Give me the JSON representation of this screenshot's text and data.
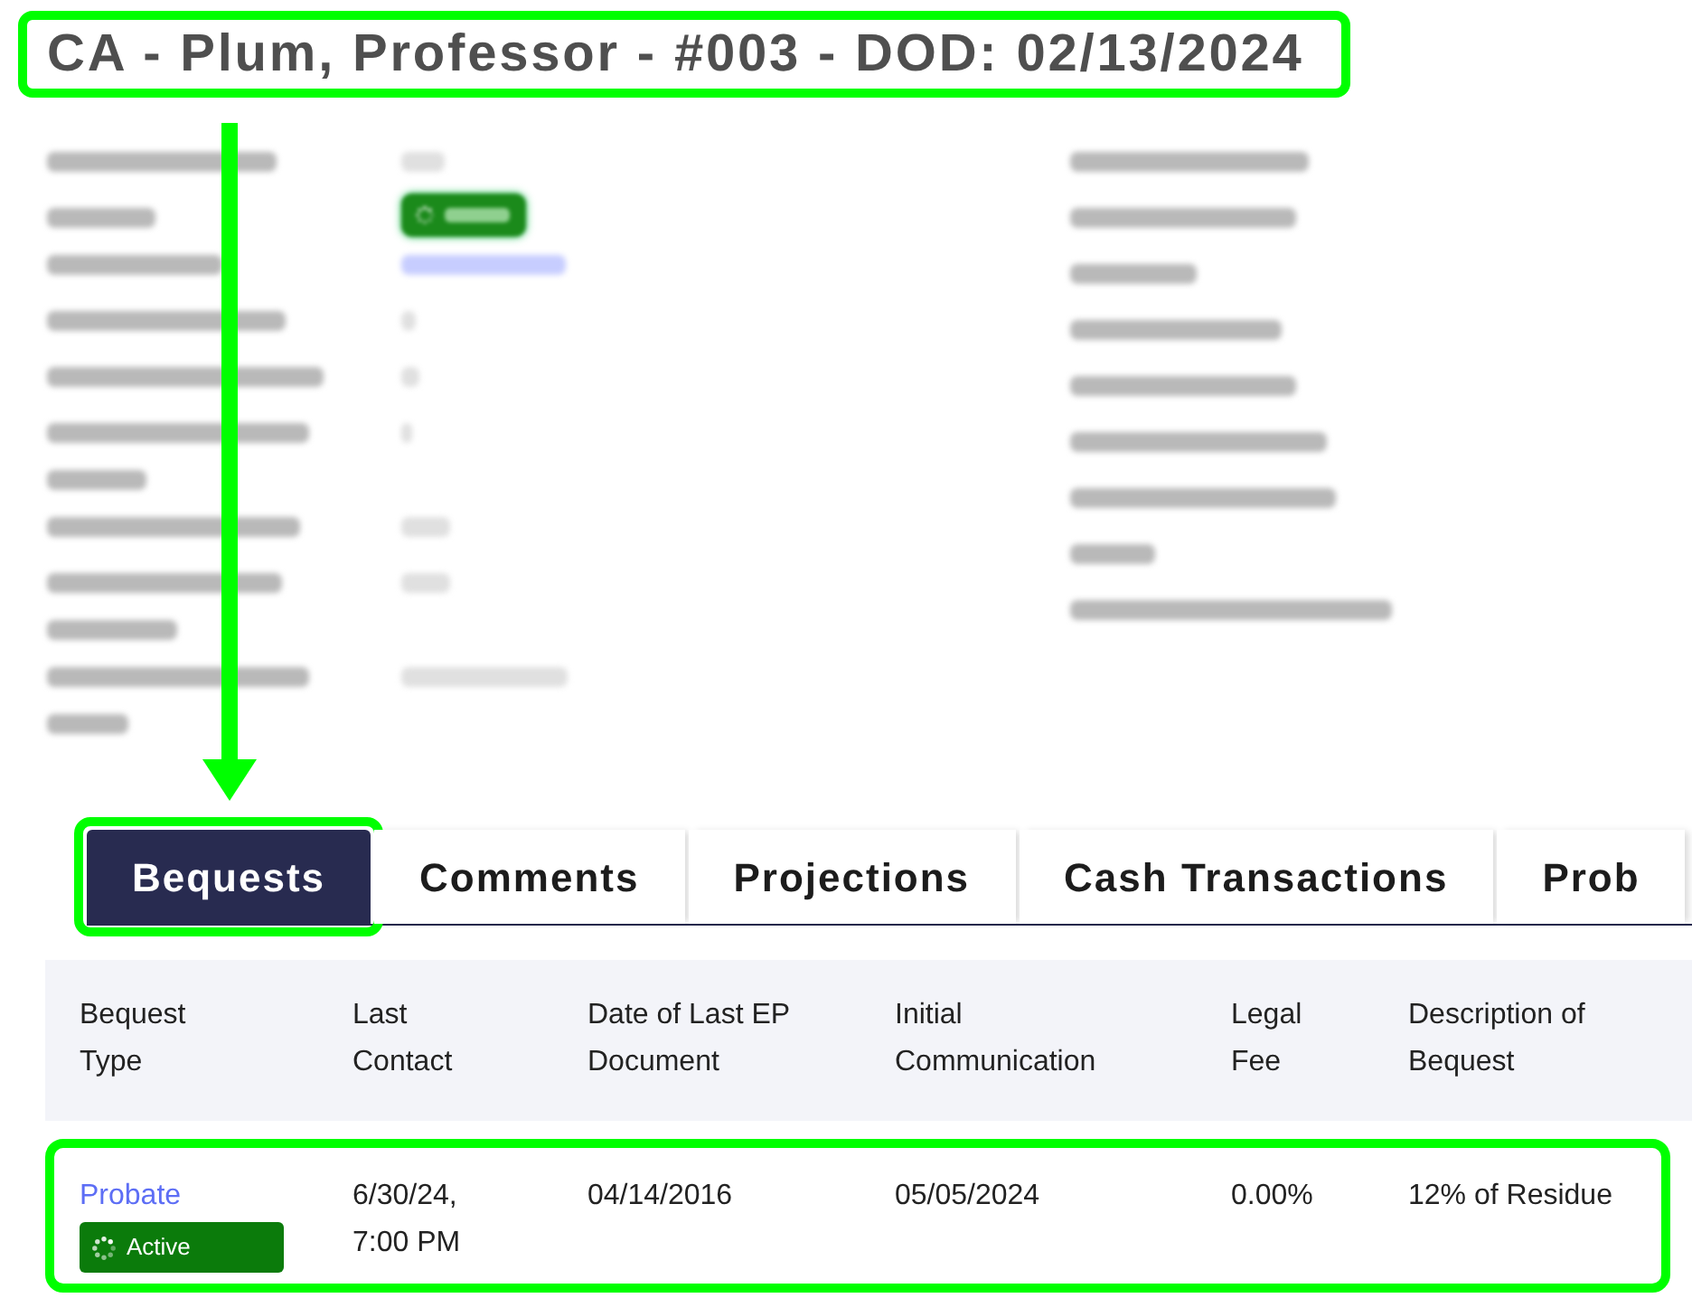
{
  "title": {
    "text": "CA - Plum, Professor - #003 - DOD: 02/13/2024",
    "highlighted": true
  },
  "details": {
    "left": [
      {
        "kind": "plain"
      },
      {
        "kind": "badge"
      },
      {
        "kind": "link"
      },
      {
        "kind": "plain"
      },
      {
        "kind": "plain"
      },
      {
        "kind": "plain"
      },
      {
        "kind": "plain"
      },
      {
        "kind": "plain"
      },
      {
        "kind": "plain"
      }
    ],
    "right": [
      {
        "kind": "bare"
      },
      {
        "kind": "bare"
      },
      {
        "kind": "bare"
      },
      {
        "kind": "bare"
      },
      {
        "kind": "bare"
      },
      {
        "kind": "bare"
      },
      {
        "kind": "bare"
      },
      {
        "kind": "bare"
      },
      {
        "kind": "bare"
      }
    ]
  },
  "tabs": [
    {
      "label": "Bequests",
      "selected": true,
      "highlighted": true
    },
    {
      "label": "Comments",
      "selected": false,
      "highlighted": false
    },
    {
      "label": "Projections",
      "selected": false,
      "highlighted": false
    },
    {
      "label": "Cash Transactions",
      "selected": false,
      "highlighted": false
    },
    {
      "label": "Prob",
      "selected": false,
      "highlighted": false
    }
  ],
  "pointer_arrow": true,
  "bequests_table": {
    "columns": [
      "Bequest Type",
      "Last Contact",
      "Date of Last EP Document",
      "Initial Communication",
      "Legal Fee",
      "Description of Bequest"
    ],
    "rows": [
      {
        "highlighted": true,
        "status": "Active",
        "cells": [
          "Probate",
          "6/30/24, 7:00 PM",
          "04/14/2016",
          "05/05/2024",
          "0.00%",
          "12% of Residue"
        ]
      }
    ]
  }
}
